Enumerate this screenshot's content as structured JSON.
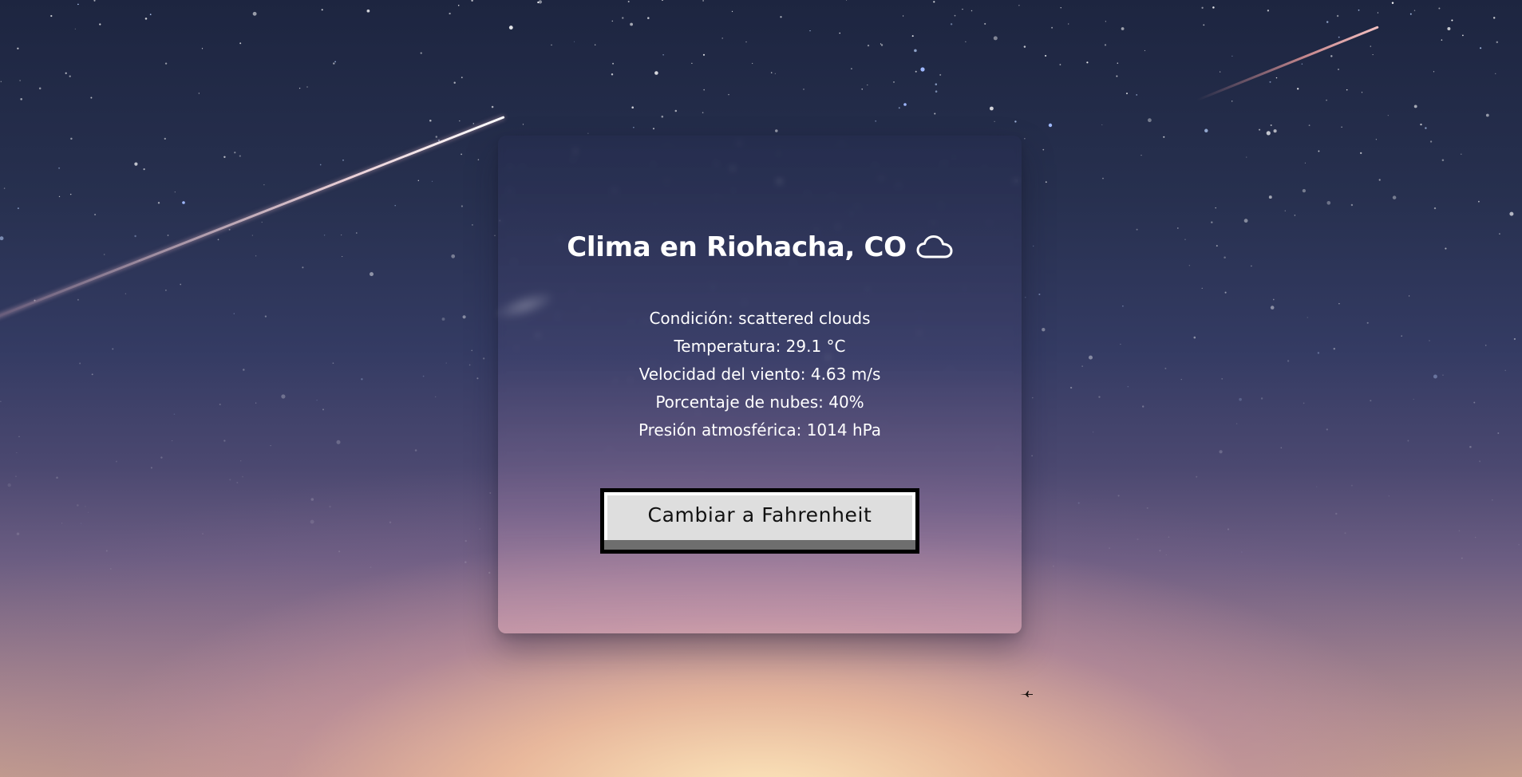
{
  "weather": {
    "title": "Clima en Riohacha, CO",
    "icon": "cloud-icon",
    "details": {
      "condition": "Condición: scattered clouds",
      "temperature": "Temperatura: 29.1 °C",
      "wind_speed": "Velocidad del viento: 4.63 m/s",
      "clouds": "Porcentaje de nubes: 40%",
      "pressure": "Presión atmosférica: 1014 hPa"
    },
    "toggle_button_label": "Cambiar a Fahrenheit"
  },
  "colors": {
    "text": "#ffffff",
    "button_bg": "#dedede",
    "button_border": "#000000",
    "sky_top": "#1d2540",
    "sky_bottom": "#c9a38d"
  }
}
